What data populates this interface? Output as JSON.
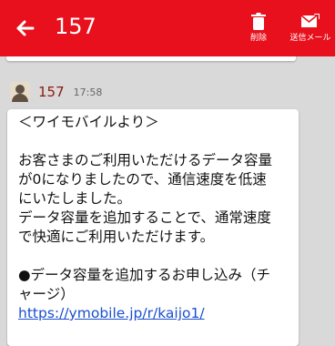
{
  "appbar": {
    "title": "157",
    "back_icon": "arrow-left-icon",
    "actions": [
      {
        "label": "削除",
        "icon": "trash-icon"
      },
      {
        "label": "送信メール",
        "icon": "envelope-send-icon"
      }
    ],
    "color": "#e8101c"
  },
  "message": {
    "sender": "157",
    "time": "17:58",
    "lines": [
      "＜ワイモバイルより＞",
      "",
      "お客さまのご利用いただけるデータ容量",
      "が0になりましたので、通信速度を低速",
      "にいたしました。",
      "データ容量を追加することで、通常速度",
      "で快適にご利用いただけます。",
      "",
      "●データ容量を追加するお申し込み（チ",
      "ャージ）"
    ],
    "link": "https://ymobile.jp/r/kaijo1/"
  }
}
